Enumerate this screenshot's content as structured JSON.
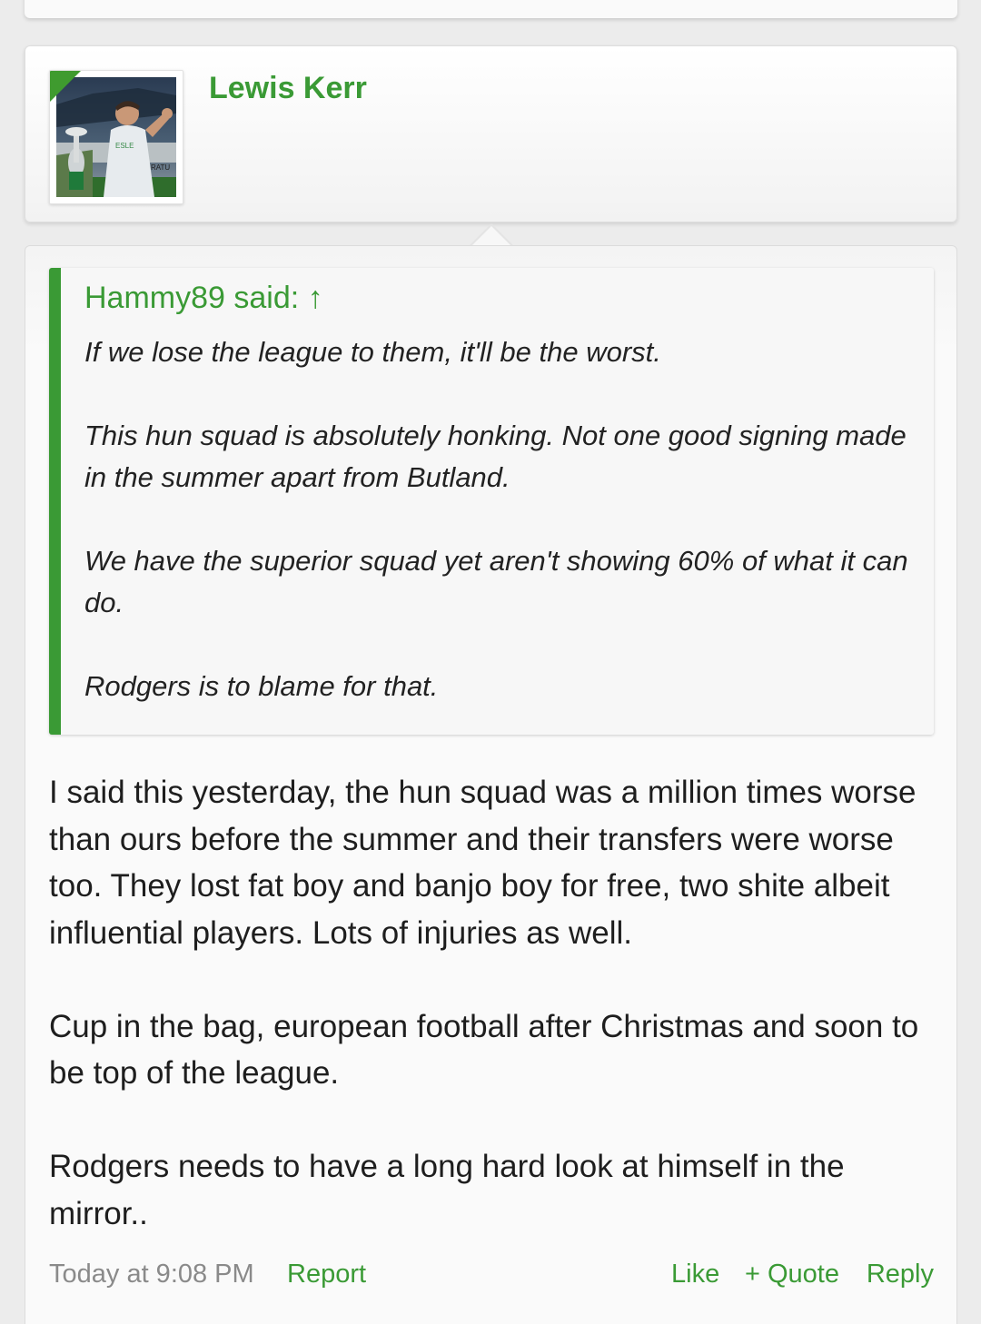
{
  "user": {
    "name": "Lewis Kerr"
  },
  "quote": {
    "author": "Hammy89 said: ↑",
    "paragraphs": [
      "If we lose the league to them, it'll be the worst.",
      "This hun squad is absolutely honking. Not one good signing made in the summer apart from Butland.",
      "We have the superior squad yet aren't showing 60% of what it can do.",
      "Rodgers is to blame for that."
    ]
  },
  "message": {
    "paragraphs": [
      "I said this yesterday, the hun squad was a million times worse than ours before the summer and their transfers were worse too. They lost fat boy and banjo boy for free, two shite albeit influential players. Lots of injuries as well.",
      "Cup in the bag, european football after Christmas and soon to be top of the league.",
      "Rodgers needs to have a long hard look at himself in the mirror.."
    ]
  },
  "footer": {
    "time": "Today at 9:08 PM",
    "report": "Report",
    "like": "Like",
    "quote": "+ Quote",
    "reply": "Reply"
  },
  "colors": {
    "accent": "#3a9a35",
    "muted": "#8a8a8a"
  }
}
